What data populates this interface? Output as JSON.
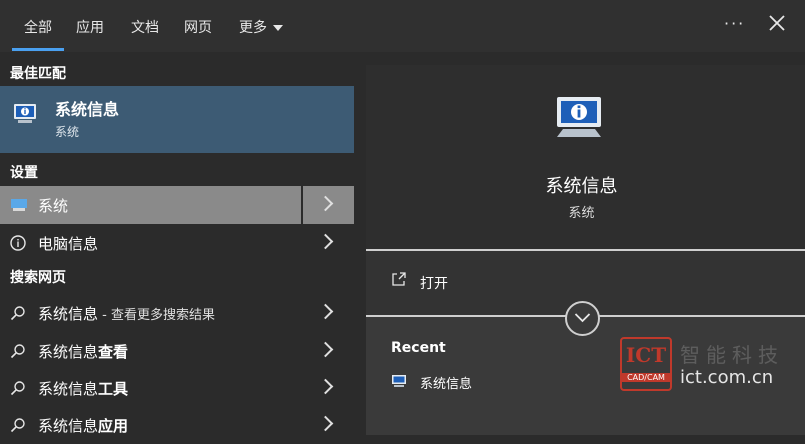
{
  "tabs": [
    {
      "label": "全部",
      "active": true
    },
    {
      "label": "应用"
    },
    {
      "label": "文档"
    },
    {
      "label": "网页"
    },
    {
      "label": "更多"
    }
  ],
  "sections": {
    "best_match": "最佳匹配",
    "settings": "设置",
    "web_search": "搜索网页"
  },
  "best_match": {
    "title": "系统信息",
    "subtitle": "系统"
  },
  "settings_items": [
    {
      "label": "系统",
      "icon": "monitor-icon"
    },
    {
      "label": "电脑信息",
      "icon": "info-icon"
    }
  ],
  "web_items": [
    {
      "prefix": "系统信息",
      "suffix": " - 查看更多搜索结果",
      "bold": ""
    },
    {
      "prefix": "系统信息",
      "bold": "查看"
    },
    {
      "prefix": "系统信息",
      "bold": "工具"
    },
    {
      "prefix": "系统信息",
      "bold": "应用"
    }
  ],
  "detail": {
    "title": "系统信息",
    "subtitle": "系统",
    "open_label": "打开",
    "recent_heading": "Recent",
    "recent_items": [
      "系统信息"
    ]
  },
  "watermark": {
    "logo": "ICT",
    "logo_sub": "CAD/CAM",
    "chars": "智能科技",
    "url": "ict.com.cn"
  },
  "colors": {
    "accent": "#4aa0f0",
    "selected_best": "#3d5b74",
    "selected_row": "#8a8a8a",
    "watermark": "#c0392b"
  }
}
